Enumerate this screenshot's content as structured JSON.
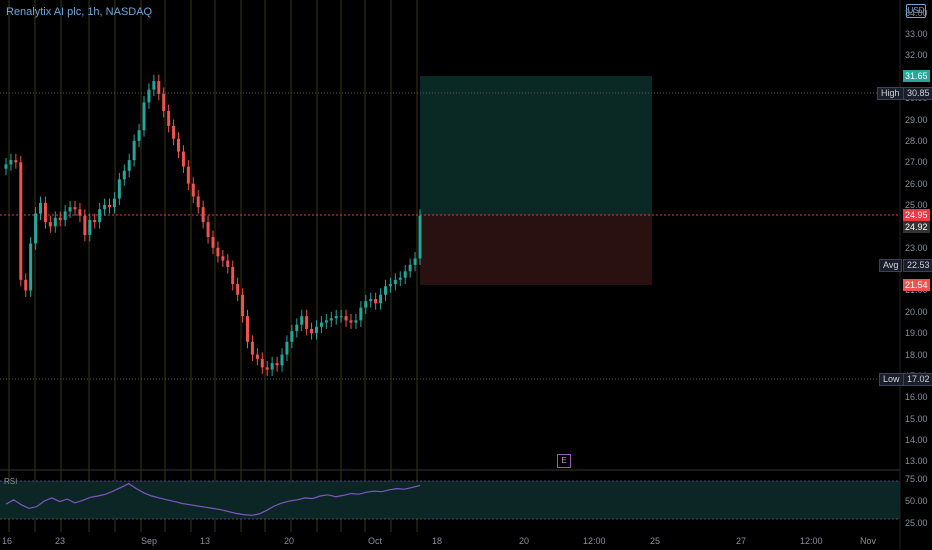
{
  "header": {
    "title": "Renalytix AI plc, 1h, NASDAQ",
    "currency": "USD"
  },
  "price_axis": {
    "ticks": [
      "34.00",
      "33.00",
      "32.00",
      "31.00",
      "30.00",
      "29.00",
      "28.00",
      "27.00",
      "26.00",
      "25.00",
      "24.00",
      "23.00",
      "22.00",
      "21.00",
      "20.00",
      "19.00",
      "18.00",
      "17.00",
      "16.00",
      "15.00",
      "14.00",
      "13.00"
    ]
  },
  "tags": {
    "target": "31.65",
    "high_label": "High",
    "high": "30.85",
    "entry": "24.95",
    "last": "24.92",
    "avg_label": "Avg",
    "avg": "22.53",
    "stop": "21.54",
    "low_label": "Low",
    "low": "17.02"
  },
  "time_axis": {
    "labels": [
      "16",
      "23",
      "Sep",
      "13",
      "20",
      "Oct",
      "18",
      "20",
      "12:00",
      "25",
      "27",
      "12:00",
      "Nov"
    ]
  },
  "rsi": {
    "label": "RSI",
    "ticks": [
      "75.00",
      "50.00",
      "25.00"
    ],
    "upper": 70,
    "lower": 30
  },
  "earnings_badge": "E",
  "colors": {
    "up": "#26a69a",
    "down": "#ef5350",
    "target_zone": "#0b2a26",
    "stop_zone": "#2b1212",
    "rsi_line": "#7e57c2",
    "entry_line": "#f23645",
    "accent": "#2962ff"
  },
  "chart_data": {
    "type": "candlestick",
    "title": "Renalytix AI plc, 1h, NASDAQ",
    "ylim": [
      12.6,
      34.5
    ],
    "candles_close": [
      26.9,
      27.1,
      27.0,
      21.5,
      21.0,
      23.2,
      24.6,
      25.1,
      24.2,
      24.0,
      24.4,
      24.3,
      24.7,
      24.9,
      24.8,
      24.5,
      23.6,
      24.3,
      24.2,
      24.8,
      25.0,
      24.9,
      25.3,
      26.2,
      26.6,
      27.1,
      28.0,
      28.5,
      29.8,
      30.4,
      30.8,
      30.2,
      29.4,
      28.7,
      28.1,
      27.5,
      26.8,
      26.0,
      25.4,
      24.9,
      24.2,
      23.5,
      23.0,
      22.6,
      22.4,
      22.1,
      21.3,
      20.8,
      19.8,
      18.6,
      18.0,
      17.8,
      17.4,
      17.3,
      17.6,
      17.5,
      18.0,
      18.6,
      19.1,
      19.4,
      19.8,
      19.2,
      19.0,
      19.3,
      19.5,
      19.6,
      19.7,
      19.8,
      19.8,
      19.6,
      19.5,
      19.6,
      20.2,
      20.5,
      20.6,
      20.4,
      20.8,
      21.2,
      21.3,
      21.5,
      21.6,
      21.9,
      22.2,
      22.5,
      24.5
    ],
    "levels": {
      "high": 30.85,
      "low": 17.02,
      "avg": 22.53,
      "entry": 24.95,
      "target": 31.65,
      "stop": 21.54,
      "last": 24.92
    },
    "rsi_values": [
      45,
      52,
      44,
      38,
      41,
      50,
      55,
      49,
      53,
      47,
      51,
      56,
      58,
      61,
      66,
      72,
      78,
      70,
      63,
      58,
      55,
      52,
      49,
      46,
      44,
      42,
      40,
      38,
      36,
      33,
      30,
      28,
      27,
      29,
      35,
      42,
      47,
      50,
      52,
      55,
      54,
      58,
      60,
      57,
      59,
      62,
      61,
      64,
      66,
      65,
      68,
      70,
      69,
      72,
      75
    ]
  }
}
